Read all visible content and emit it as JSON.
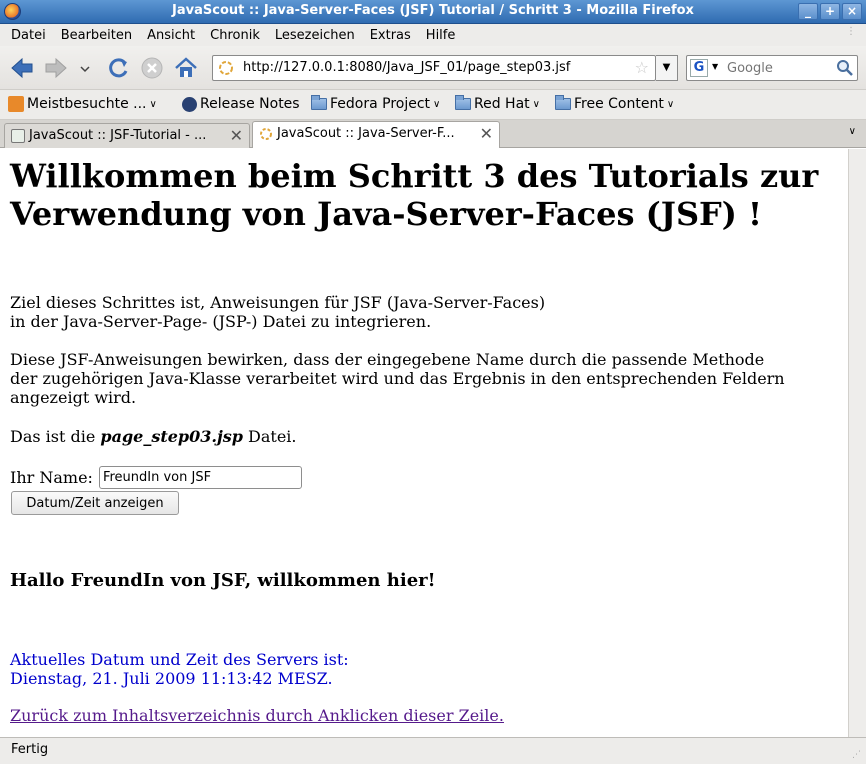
{
  "window": {
    "title": "JavaScout :: Java-Server-Faces (JSF) Tutorial / Schritt 3 - Mozilla Firefox",
    "buttons": [
      "_",
      "+",
      "×"
    ]
  },
  "menu": {
    "items": [
      "Datei",
      "Bearbeiten",
      "Ansicht",
      "Chronik",
      "Lesezeichen",
      "Extras",
      "Hilfe"
    ]
  },
  "nav": {
    "url": "http://127.0.0.1:8080/Java_JSF_01/page_step03.jsf",
    "search_placeholder": "Google",
    "search_engine_letter": "G"
  },
  "bookmarks": {
    "items": [
      {
        "label": "Meistbesuchte ...",
        "icon": "rss-feed-icon"
      },
      {
        "label": "Release Notes",
        "icon": "fedora-icon"
      },
      {
        "label": "Fedora Project",
        "icon": "folder-icon"
      },
      {
        "label": "Red Hat",
        "icon": "folder-icon"
      },
      {
        "label": "Free Content",
        "icon": "folder-icon"
      }
    ]
  },
  "tabs": [
    {
      "label": "JavaScout :: JSF-Tutorial - ...",
      "active": false
    },
    {
      "label": "JavaScout :: Java-Server-F...",
      "active": true
    }
  ],
  "page": {
    "heading": "Willkommen beim Schritt 3 des Tutorials zur Verwendung von Java-Server-Faces (JSF) !",
    "intro_line1": "Ziel dieses Schrittes ist, Anweisungen für JSF (Java-Server-Faces)",
    "intro_line2": "in der Java-Server-Page- (JSP-) Datei zu integrieren.",
    "desc_line1": "Diese JSF-Anweisungen bewirken, dass der eingegebene Name durch die passende Methode",
    "desc_line2": "der zugehörigen Java-Klasse verarbeitet wird und das Ergebnis in den entsprechenden Feldern",
    "desc_line3": "angezeigt wird.",
    "file_prefix": "Das ist die ",
    "file_name": "page_step03.jsp",
    "file_suffix": " Datei.",
    "name_label": "Ihr Name:",
    "name_value": "FreundIn von JSF",
    "show_button": "Datum/Zeit anzeigen",
    "greeting": "Hallo FreundIn von JSF, willkommen hier!",
    "date_line1": "Aktuelles Datum und Zeit des Servers ist:",
    "date_line2": "Dienstag, 21. Juli 2009 11:13:42 MESZ.",
    "back_link": "Zurück zum Inhaltsverzeichnis durch Anklicken dieser Zeile."
  },
  "status": {
    "text": "Fertig"
  },
  "colors": {
    "titlebar": "#2f6bb1",
    "date_text": "#0000cc",
    "visited_link": "#551a8b"
  }
}
